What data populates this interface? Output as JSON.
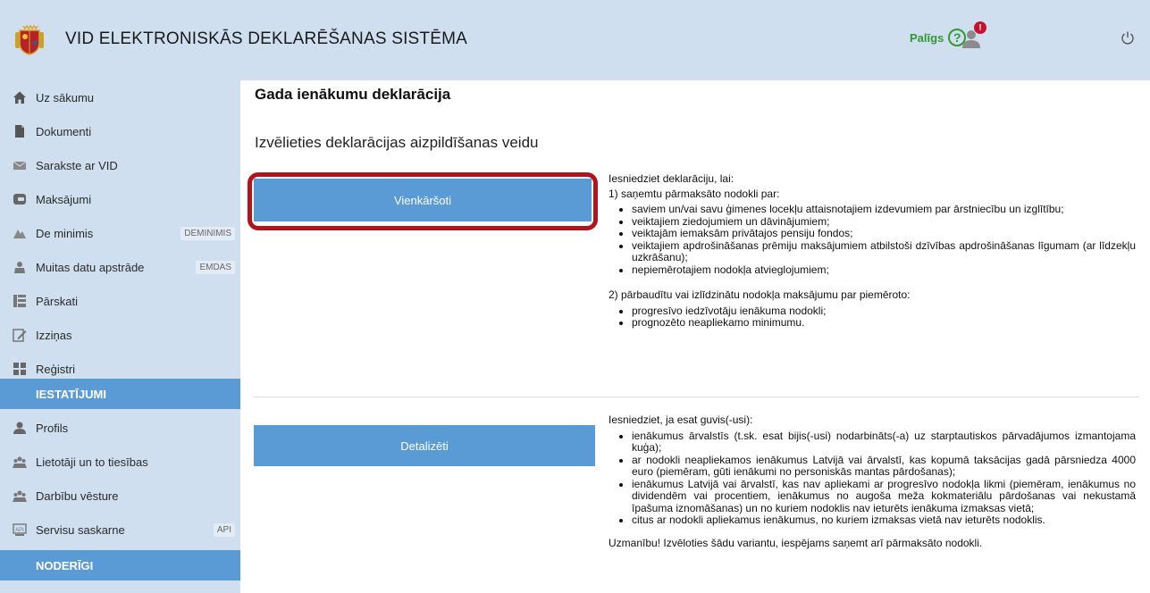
{
  "header": {
    "title": "VID ELEKTRONISKĀS DEKLARĒŠANAS SISTĒMA",
    "help_label": "Palīgs",
    "help_icon_glyph": "?",
    "notification_count": "!",
    "colors": {
      "header_bg": "#cfdff0",
      "help_green": "#2f9a2f",
      "badge_red": "#c8102e"
    }
  },
  "sidebar": {
    "items": [
      {
        "label": "Uz sākumu",
        "icon": "home-icon"
      },
      {
        "label": "Dokumenti",
        "icon": "document-icon"
      },
      {
        "label": "Sarakste ar VID",
        "icon": "envelope-icon"
      },
      {
        "label": "Maksājumi",
        "icon": "payment-icon"
      },
      {
        "label": "De minimis",
        "icon": "de-minimis-icon",
        "tag": "DEMINIMIS"
      },
      {
        "label": "Muitas datu apstrāde",
        "icon": "customs-icon",
        "tag": "EMDAS"
      },
      {
        "label": "Pārskati",
        "icon": "reports-icon"
      },
      {
        "label": "Izziņas",
        "icon": "certificate-icon"
      },
      {
        "label": "Reģistri",
        "icon": "registers-icon"
      }
    ],
    "section_settings": "IESTATĪJUMI",
    "settings_items": [
      {
        "label": "Profils",
        "icon": "profile-icon"
      },
      {
        "label": "Lietotāji un to tiesības",
        "icon": "users-icon"
      },
      {
        "label": "Darbību vēsture",
        "icon": "history-icon"
      },
      {
        "label": "Servisu saskarne",
        "icon": "api-icon",
        "tag": "API"
      }
    ],
    "section_useful": "NODERĪGI"
  },
  "main": {
    "title": "Gada ienākumu deklarācija",
    "subtitle": "Izvēlieties deklarācijas aizpildīšanas veidu",
    "option_simple": {
      "button_label": "Vienkāršoti",
      "intro": "Iesniedziet deklarāciju, lai:",
      "point1": "1) saņemtu pārmaksāto nodokli par:",
      "point1_items": [
        "saviem un/vai savu ģimenes locekļu attaisnotajiem izdevumiem par ārstniecību un izglītību;",
        "veiktajiem ziedojumiem un dāvinājumiem;",
        "veiktajām iemaksām privātajos pensiju fondos;",
        "veiktajiem apdrošināšanas prēmiju maksājumiem atbilstoši dzīvības apdrošināšanas līgumam (ar līdzekļu uzkrāšanu);",
        "nepiemērotajiem nodokļa atvieglojumiem;"
      ],
      "point2": "2) pārbaudītu vai izlīdzinātu nodokļa maksājumu par piemēroto:",
      "point2_items": [
        "progresīvo iedzīvotāju ienākuma nodokli;",
        "prognozēto neapliekamo minimumu."
      ]
    },
    "option_detailed": {
      "button_label": "Detalizēti",
      "intro": "Iesniedziet, ja esat guvis(-usi):",
      "items": [
        "ienākumus ārvalstīs (t.sk. esat bijis(-usi) nodarbināts(-a) uz starptautiskos pārvadājumos izmantojama kuģa);",
        "ar nodokli neapliekamos ienākumus Latvijā vai ārvalstī, kas kopumā taksācijas gadā pārsniedza 4000 euro (piemēram, gūti ienākumi no personiskās mantas pārdošanas);",
        "ienākumus Latvijā vai ārvalstī, kas nav apliekami ar progresīvo nodokļa likmi (piemēram, ienākumus no dividendēm vai procentiem, ienākumus no augoša meža kokmateriālu pārdošanas vai nekustamā īpašuma iznomāšanas) un no kuriem nodoklis nav ieturēts ienākuma izmaksas vietā;",
        "citus ar nodokli apliekamus ienākumus, no kuriem izmaksas vietā nav ieturēts nodoklis."
      ],
      "note": "Uzmanību! Izvēloties šādu variantu, iespējams saņemt arī pārmaksāto nodokli."
    },
    "colors": {
      "button_blue": "#5b9bd5",
      "highlight_red": "#b0141c"
    }
  }
}
